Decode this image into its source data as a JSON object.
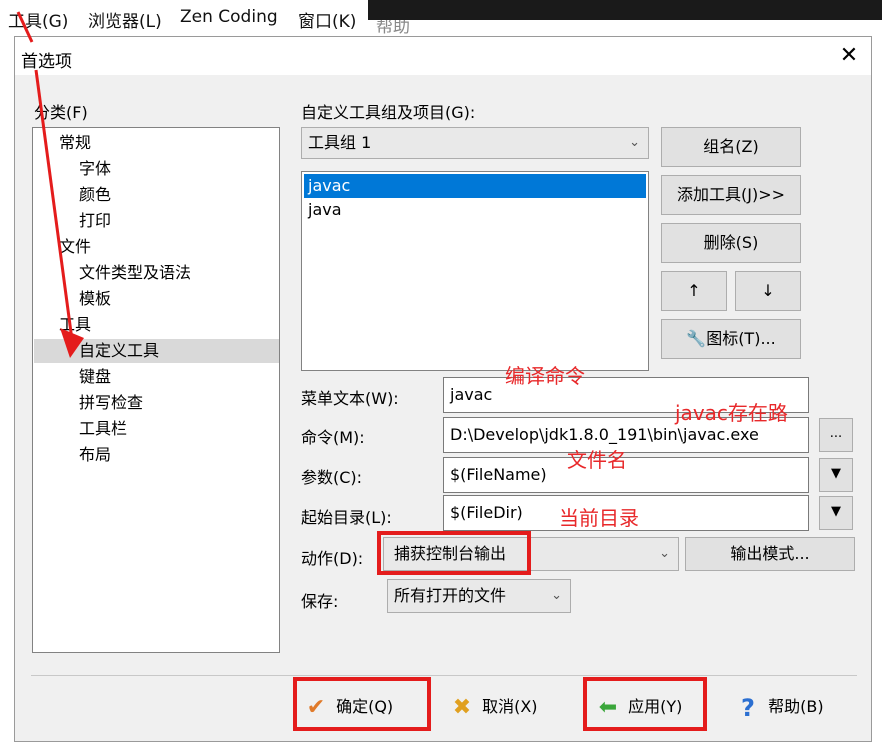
{
  "menubar": {
    "items": [
      "工具(G)",
      "浏览器(L)",
      "Zen Coding",
      "窗口(K)",
      "帮助"
    ]
  },
  "dialog": {
    "title": "首选项",
    "close": "✕",
    "category_label": "分类(F)",
    "tree": [
      "常规",
      "字体",
      "颜色",
      "打印",
      "文件",
      "文件类型及语法",
      "模板",
      "工具",
      "自定义工具",
      "键盘",
      "拼写检查",
      "工具栏",
      "布局"
    ],
    "selected_tree_item": "自定义工具",
    "groups_label": "自定义工具组及项目(G):",
    "group_combo": "工具组 1",
    "tools": [
      "javac",
      "java"
    ],
    "selected_tool": "javac",
    "buttons": {
      "group_name": "组名(Z)",
      "add_tool": "添加工具(J)>>",
      "delete": "删除(S)",
      "up": "↑",
      "down": "↓",
      "icon": "图标(T)...",
      "output_mode": "输出模式...",
      "browse": "..."
    },
    "fields": {
      "menu_text_label": "菜单文本(W):",
      "menu_text": "javac",
      "command_label": "命令(M):",
      "command": "D:\\Develop\\jdk1.8.0_191\\bin\\javac.exe",
      "args_label": "参数(C):",
      "args": "$(FileName)",
      "start_dir_label": "起始目录(L):",
      "start_dir": "$(FileDir)",
      "action_label": "动作(D):",
      "action": "捕获控制台输出",
      "save_label": "保存:",
      "save": "所有打开的文件"
    },
    "annotations": {
      "compile_cmd": "编译命令",
      "javac_path": "javac存在路",
      "file_name": "文件名",
      "current_dir": "当前目录"
    },
    "footer": {
      "ok": "确定(Q)",
      "cancel": "取消(X)",
      "apply": "应用(Y)",
      "help": "帮助(B)"
    }
  },
  "colors": {
    "annotation_red": "#e8282a",
    "selection_blue": "#0078d7"
  }
}
